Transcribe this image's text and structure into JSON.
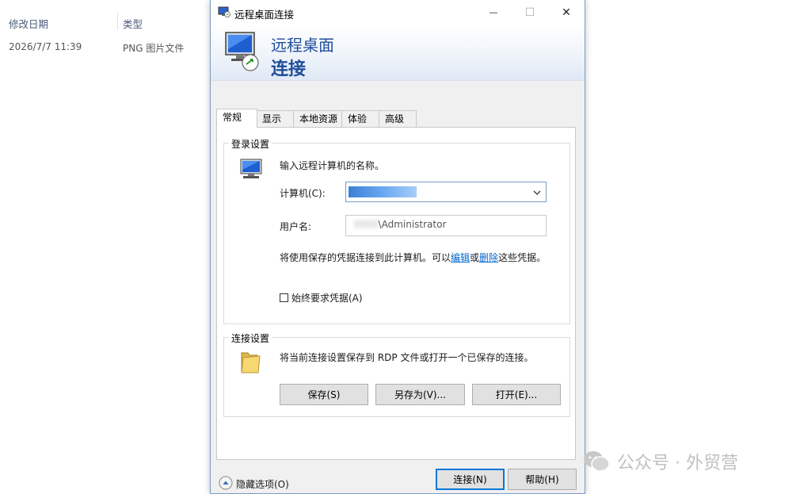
{
  "background_explorer": {
    "columns": [
      {
        "label": "修改日期"
      },
      {
        "label": "类型"
      }
    ],
    "row": {
      "date": "2026/7/7 11:39",
      "type": "PNG 图片文件"
    }
  },
  "dialog": {
    "title": "远程桌面连接",
    "banner": {
      "line1": "远程桌面",
      "line2": "连接"
    },
    "window_buttons": {
      "minimize": "—",
      "maximize": "☐",
      "close": "✕"
    },
    "tabs": [
      {
        "label": "常规",
        "active": true
      },
      {
        "label": "显示"
      },
      {
        "label": "本地资源"
      },
      {
        "label": "体验"
      },
      {
        "label": "高级"
      }
    ],
    "login": {
      "group_title": "登录设置",
      "instruction": "输入远程计算机的名称。",
      "computer_label": "计算机(C):",
      "computer_value": "",
      "username_label": "用户名:",
      "username_blurred": "            0000",
      "username_suffix": "\\Administrator",
      "credential_text_prefix": "将使用保存的凭据连接到此计算机。可以",
      "edit_link": "编辑",
      "or": "或",
      "delete_link": "删除",
      "credential_text_suffix": "这些凭据。",
      "always_ask_label": "始终要求凭据(A)"
    },
    "connection": {
      "group_title": "连接设置",
      "description": "将当前连接设置保存到 RDP 文件或打开一个已保存的连接。",
      "save_button": "保存(S)",
      "save_as_button": "另存为(V)...",
      "open_button": "打开(E)..."
    },
    "footer": {
      "hide_options": "隐藏选项(O)",
      "connect_button": "连接(N)",
      "help_button": "帮助(H)"
    }
  },
  "watermark": {
    "text": "公众号 · 外贸营"
  },
  "colors": {
    "accent": "#1f4e9c",
    "link": "#0066cc",
    "focus_border": "#0078d7"
  }
}
